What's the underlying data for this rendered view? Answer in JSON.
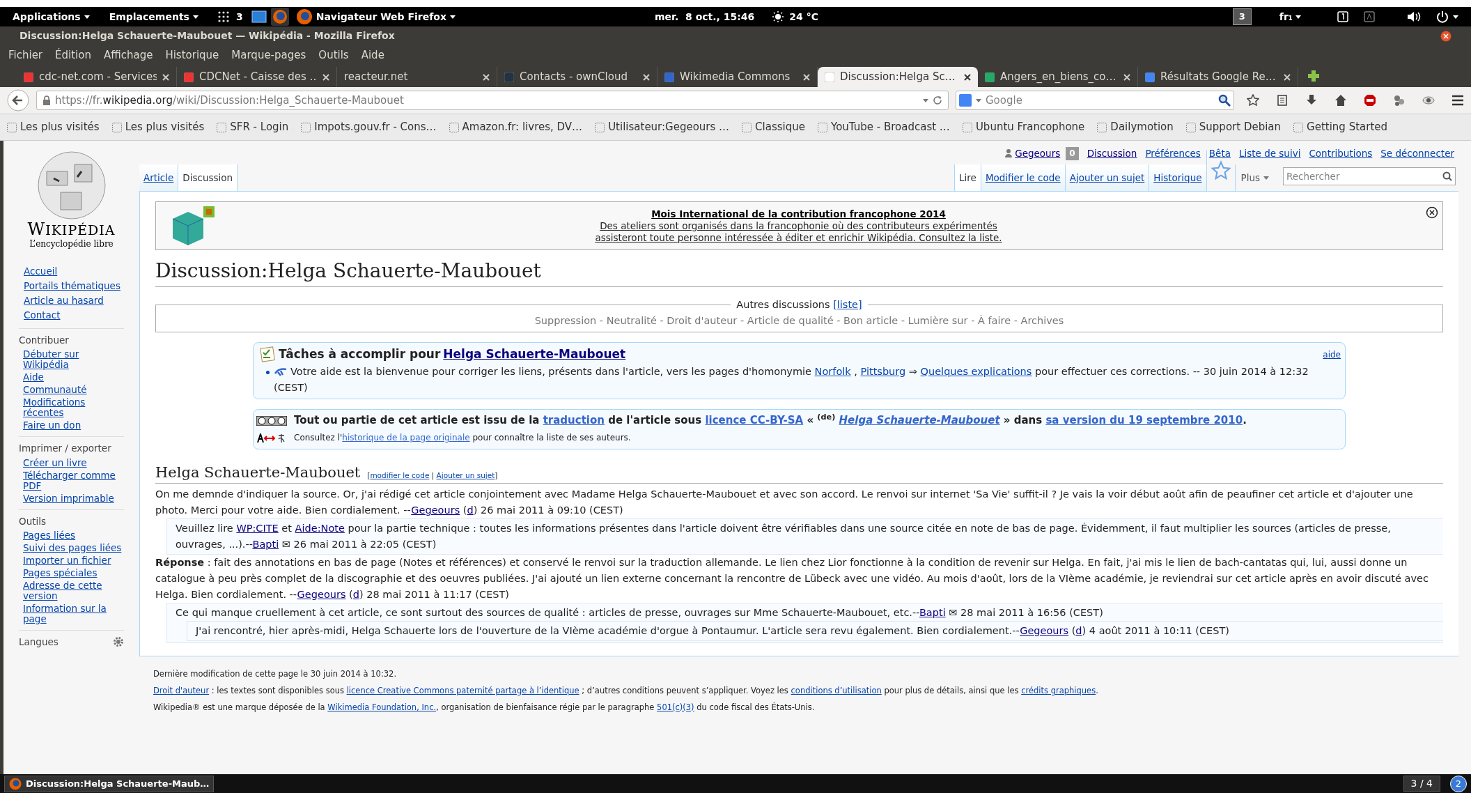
{
  "top_panel": {
    "menus": [
      "Applications",
      "Emplacements"
    ],
    "workspace": "3",
    "active_app": "Navigateur Web Firefox",
    "clock": "mer.  8 oct., 15:46",
    "weather": "24 °C",
    "workspace_indicator": "3",
    "keyboard": "fr₁"
  },
  "window": {
    "title": "Discussion:Helga Schauerte-Maubouet — Wikipédia - Mozilla Firefox"
  },
  "menu": [
    "Fichier",
    "Édition",
    "Affichage",
    "Historique",
    "Marque-pages",
    "Outils",
    "Aide"
  ],
  "tabs": [
    {
      "label": "cdc-net.com - Services",
      "selected": false
    },
    {
      "label": "CDCNet - Caisse des …",
      "selected": false
    },
    {
      "label": "reacteur.net",
      "selected": false
    },
    {
      "label": "Contacts - ownCloud",
      "selected": false
    },
    {
      "label": "Wikimedia Commons",
      "selected": false
    },
    {
      "label": "Discussion:Helga Sc…",
      "selected": true
    },
    {
      "label": "Angers_en_biens_co…",
      "selected": false
    },
    {
      "label": "Résultats Google Re…",
      "selected": false
    }
  ],
  "navbar": {
    "url": "https://fr.**wikipedia.org**/wiki/Discussion:Helga_Schauerte-Maubouet",
    "search_placeholder": "Google"
  },
  "bookmarks": [
    "Les plus visités",
    "Les plus visités",
    "SFR - Login",
    "Impots.gouv.fr - Cons…",
    "Amazon.fr: livres, DV…",
    "Utilisateur:Gegeours …",
    "Classique",
    "YouTube - Broadcast …",
    "Ubuntu Francophone",
    "Dailymotion",
    "Support Debian",
    "Getting Started"
  ],
  "wiki": {
    "logo": {
      "name": "WIKIPÉDIA",
      "tagline": "L’encyclopédie libre"
    },
    "personal": {
      "user": "Gegeours",
      "notifications": "0",
      "links": [
        "Discussion",
        "Préférences",
        "Bêta",
        "Liste de suivi",
        "Contributions",
        "Se déconnecter"
      ]
    },
    "namespaces": [
      {
        "label": "Article",
        "selected": false
      },
      {
        "label": "Discussion",
        "selected": true
      }
    ],
    "views": [
      {
        "label": "Lire",
        "selected": true
      },
      {
        "label": "Modifier le code",
        "selected": false
      },
      {
        "label": "Ajouter un sujet",
        "selected": false
      },
      {
        "label": "Historique",
        "selected": false
      }
    ],
    "more": "Plus",
    "search_placeholder": "Rechercher",
    "sidebar": {
      "nav": [
        "Accueil",
        "Portails thématiques",
        "Article au hasard",
        "Contact"
      ],
      "sections": [
        {
          "heading": "Contribuer",
          "items": [
            "Débuter sur Wikipédia",
            "Aide",
            "Communauté",
            "Modifications récentes",
            "Faire un don"
          ]
        },
        {
          "heading": "Imprimer / exporter",
          "items": [
            "Créer un livre",
            "Télécharger comme PDF",
            "Version imprimable"
          ]
        },
        {
          "heading": "Outils",
          "items": [
            "Pages liées",
            "Suivi des pages liées",
            "Importer un fichier",
            "Pages spéciales",
            "Adresse de cette version",
            "Information sur la page"
          ]
        }
      ],
      "languages": "Langues"
    },
    "banner": {
      "title": "Mois International de la contribution francophone 2014",
      "lines": [
        "Des ateliers sont organisés dans la francophonie où des contributeurs expérimentés",
        "assisteront toute personne intéressée à éditer et enrichir Wikipédia. Consultez la liste."
      ]
    },
    "heading": "Discussion:Helga Schauerte-Maubouet",
    "other_talks": {
      "label": "Autres discussions",
      "link": "[liste]",
      "items": "Suppression - Neutralité - Droit d'auteur - Article de qualité - Bon article - Lumière sur - À faire - Archives"
    },
    "tasks": {
      "title": "Tâches à accomplir pour",
      "title_link": "Helga Schauerte-Maubouet",
      "help": "aide",
      "item": [
        {
          "t": "Votre aide est la bienvenue pour corriger les liens, présents dans l'article, vers les pages d'homonymie "
        },
        {
          "t": "Norfolk",
          "link": true
        },
        {
          "t": " , "
        },
        {
          "t": "Pittsburg",
          "link": true
        },
        {
          "t": " ⇒ "
        },
        {
          "t": "Quelques explications",
          "link": true
        },
        {
          "t": " pour effectuer ces corrections. -- 30 juin 2014 à 12:32 (CEST)"
        }
      ]
    },
    "translation": {
      "line": [
        {
          "t": "Tout ou partie de cet article est issu de la "
        },
        {
          "t": "traduction",
          "link": true
        },
        {
          "t": " de l'article sous "
        },
        {
          "t": "licence CC-BY-SA",
          "link": true
        },
        {
          "t": " « $^{(de)}$ "
        },
        {
          "t": "*Helga Schauerte-Maubouet*",
          "link": true
        },
        {
          "t": " » dans "
        },
        {
          "t": "sa version du 19 septembre 2010",
          "link": true
        },
        {
          "t": "."
        }
      ],
      "note": [
        {
          "t": "Consultez l'"
        },
        {
          "t": "historique de la page originale",
          "link": true
        },
        {
          "t": " pour connaître la liste de ses auteurs."
        }
      ]
    },
    "section": {
      "title": "Helga Schauerte-Maubouet",
      "edit": [
        {
          "t": "["
        },
        {
          "t": "modifier le code",
          "link": true
        },
        {
          "t": " | "
        },
        {
          "t": "Ajouter un sujet",
          "link": true
        },
        {
          "t": "]"
        }
      ]
    },
    "comments": [
      {
        "segments": [
          {
            "t": "On me demnde d'indiquer la source. Or, j'ai rédigé cet article conjointement avec Madame Helga Schauerte-Maubouet et avec son accord. Le renvoi sur internet 'Sa Vie' suffit-il ? Je vais la voir début août afin de peaufiner cet article et d'ajouter une photo. Merci pour votre aide. Bien cordialement. --"
          },
          {
            "t": "Gegeours",
            "link": true
          },
          {
            "t": " ("
          },
          {
            "t": "d",
            "link": true
          },
          {
            "t": ") 26 mai 2011 à 09:10 (CEST)"
          }
        ],
        "children": [
          {
            "segments": [
              {
                "t": "Veuillez lire "
              },
              {
                "t": "WP:CITE",
                "link": true
              },
              {
                "t": " et "
              },
              {
                "t": "Aide:Note",
                "link": true
              },
              {
                "t": " pour la partie technique : toutes les informations présentes dans l'article doivent être vérifiables dans une source citée en note de bas de page. Évidemment, il faut multiplier les sources (articles de presse, ouvrages, ...).--"
              },
              {
                "t": "Bapti",
                "link": true
              },
              {
                "t": " ✉ 26 mai 2011 à 22:05 (CEST)"
              }
            ]
          }
        ]
      },
      {
        "segments": [
          {
            "t": "**Réponse** : fait des annotations en bas de page (Notes et références) et conservé le renvoi sur la traduction allemande. Le lien chez Lior fonctionne à la condition de revenir sur Helga. En fait, j'ai mis le lien de bach-cantatas qui, lui, aussi donne un catalogue à peu près complet de la discographie et des oeuvres publiées. J'ai ajouté un lien externe concernant la rencontre de Lübeck avec une vidéo. Au mois d'août, lors de la VIème académie, je reviendrai sur cet article après en avoir discuté avec Helga. Bien cordialement. --"
          },
          {
            "t": "Gegeours",
            "link": true
          },
          {
            "t": " ("
          },
          {
            "t": "d",
            "link": true
          },
          {
            "t": ") 28 mai 2011 à 11:17 (CEST)"
          }
        ],
        "children": [
          {
            "segments": [
              {
                "t": "Ce qui manque cruellement à cet article, ce sont surtout des sources de qualité : articles de presse, ouvrages sur Mme Schauerte-Maubouet, etc.--"
              },
              {
                "t": "Bapti",
                "link": true
              },
              {
                "t": " ✉ 28 mai 2011 à 16:56 (CEST)"
              }
            ],
            "children": [
              {
                "segments": [
                  {
                    "t": "J'ai rencontré, hier après-midi, Helga Schauerte lors de l'ouverture de la VIème académie d'orgue à Pontaumur. L'article sera revu également. Bien cordialement.--"
                  },
                  {
                    "t": "Gegeours",
                    "link": true
                  },
                  {
                    "t": " ("
                  },
                  {
                    "t": "d",
                    "link": true
                  },
                  {
                    "t": ") 4 août 2011 à 10:11 (CEST)"
                  }
                ]
              }
            ]
          }
        ]
      }
    ],
    "footer": [
      [
        {
          "t": "Dernière modification de cette page le 30 juin 2014 à 10:32."
        }
      ],
      [
        {
          "t": "Droit d'auteur",
          "link": true
        },
        {
          "t": " : les textes sont disponibles sous "
        },
        {
          "t": "licence Creative Commons paternité partage à l’identique",
          "link": true
        },
        {
          "t": " ; d’autres conditions peuvent s’appliquer. Voyez les "
        },
        {
          "t": "conditions d’utilisation",
          "link": true
        },
        {
          "t": " pour plus de détails, ainsi que les "
        },
        {
          "t": "crédits graphiques",
          "link": true
        },
        {
          "t": "."
        }
      ],
      [
        {
          "t": "Wikipedia® est une marque déposée de la "
        },
        {
          "t": "Wikimedia Foundation, Inc.",
          "link": true
        },
        {
          "t": ", organisation de bienfaisance régie par le paragraphe "
        },
        {
          "t": "501(c)(3)",
          "link": true
        },
        {
          "t": " du code fiscal des États-Unis."
        }
      ]
    ]
  },
  "taskbar": {
    "window": "Discussion:Helga Schauerte-Maub…",
    "pager": "3 / 4",
    "badge": "2"
  }
}
